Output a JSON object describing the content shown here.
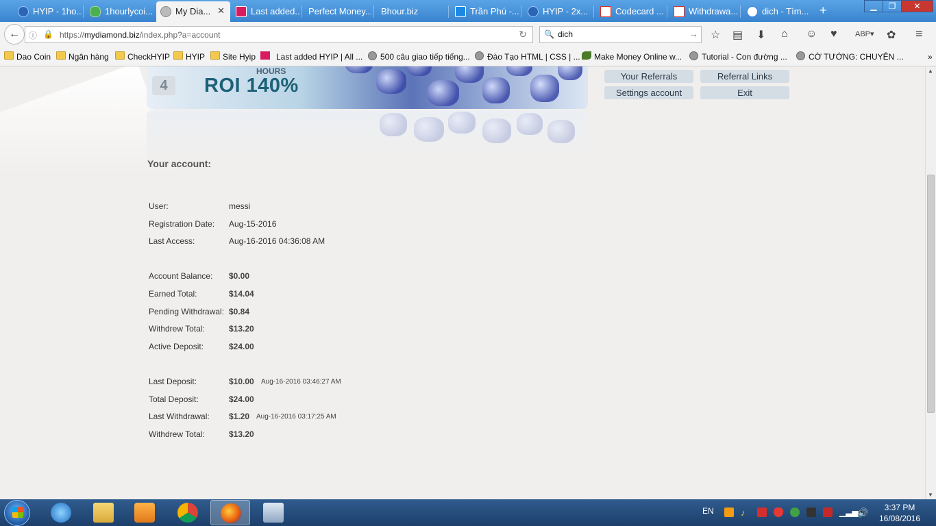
{
  "browser": {
    "tabs": [
      {
        "label": "HYIP - 1ho...",
        "active": false
      },
      {
        "label": "1hourlycoi...",
        "active": false
      },
      {
        "label": "My Dia...",
        "active": true
      },
      {
        "label": "Last added...",
        "active": false
      },
      {
        "label": "Perfect Money...",
        "active": false
      },
      {
        "label": "Bhour.biz",
        "active": false
      },
      {
        "label": "Trần Phú -...",
        "active": false
      },
      {
        "label": "HYIP - 2x...",
        "active": false
      },
      {
        "label": "Codecard ...",
        "active": false
      },
      {
        "label": "Withdrawa...",
        "active": false
      },
      {
        "label": "dich - Tìm...",
        "active": false
      }
    ],
    "url_prefix": "https://",
    "url_domain": "mydiamond.biz",
    "url_path": "/index.php?a=account",
    "search_value": "dich",
    "bookmarks": [
      {
        "label": "Dao Coin",
        "icon": "folder"
      },
      {
        "label": "Ngân hàng",
        "icon": "folder"
      },
      {
        "label": "CheckHYIP",
        "icon": "folder"
      },
      {
        "label": "HYIP",
        "icon": "folder"
      },
      {
        "label": "Site Hyip",
        "icon": "folder"
      },
      {
        "label": "Last added HYIP | All ...",
        "icon": "red"
      },
      {
        "label": "500 câu giao tiếp tiếng...",
        "icon": "globe"
      },
      {
        "label": "Đào Tạo HTML | CSS | ...",
        "icon": "globe"
      },
      {
        "label": "Make Money Online w...",
        "icon": "leaf"
      },
      {
        "label": "Tutorial - Con đường ...",
        "icon": "globe"
      },
      {
        "label": "CỜ TƯỚNG: CHUYÊN ...",
        "icon": "globe"
      }
    ],
    "bookmarks_overflow": "»"
  },
  "banner": {
    "number": "4",
    "hours_label": "HOURS",
    "roi_text": "ROI 140%"
  },
  "menu": {
    "your_referrals": "Your Referrals",
    "referral_links": "Referral Links",
    "settings_account": "Settings account",
    "exit": "Exit"
  },
  "account": {
    "title": "Your account:",
    "user_label": "User:",
    "user_value": "messi",
    "reg_label": "Registration Date:",
    "reg_value": "Aug-15-2016",
    "last_access_label": "Last Access:",
    "last_access_value": "Aug-16-2016 04:36:08 AM",
    "balance_label": "Account Balance:",
    "balance_value": "$0.00",
    "earned_label": "Earned Total:",
    "earned_value": "$14.04",
    "pending_label": "Pending Withdrawal:",
    "pending_value": "$0.84",
    "withdrew_label": "Withdrew Total:",
    "withdrew_value": "$13.20",
    "active_label": "Active Deposit:",
    "active_value": "$24.00",
    "last_deposit_label": "Last Deposit:",
    "last_deposit_value": "$10.00",
    "last_deposit_time": "Aug-16-2016 03:46:27 AM",
    "total_deposit_label": "Total Deposit:",
    "total_deposit_value": "$24.00",
    "last_withdrawal_label": "Last Withdrawal:",
    "last_withdrawal_value": "$1.20",
    "last_withdrawal_time": "Aug-16-2016 03:17:25 AM",
    "withdrew2_label": "Withdrew Total:",
    "withdrew2_value": "$13.20"
  },
  "taskbar": {
    "language": "EN",
    "time": "3:37 PM",
    "date": "16/08/2016"
  }
}
